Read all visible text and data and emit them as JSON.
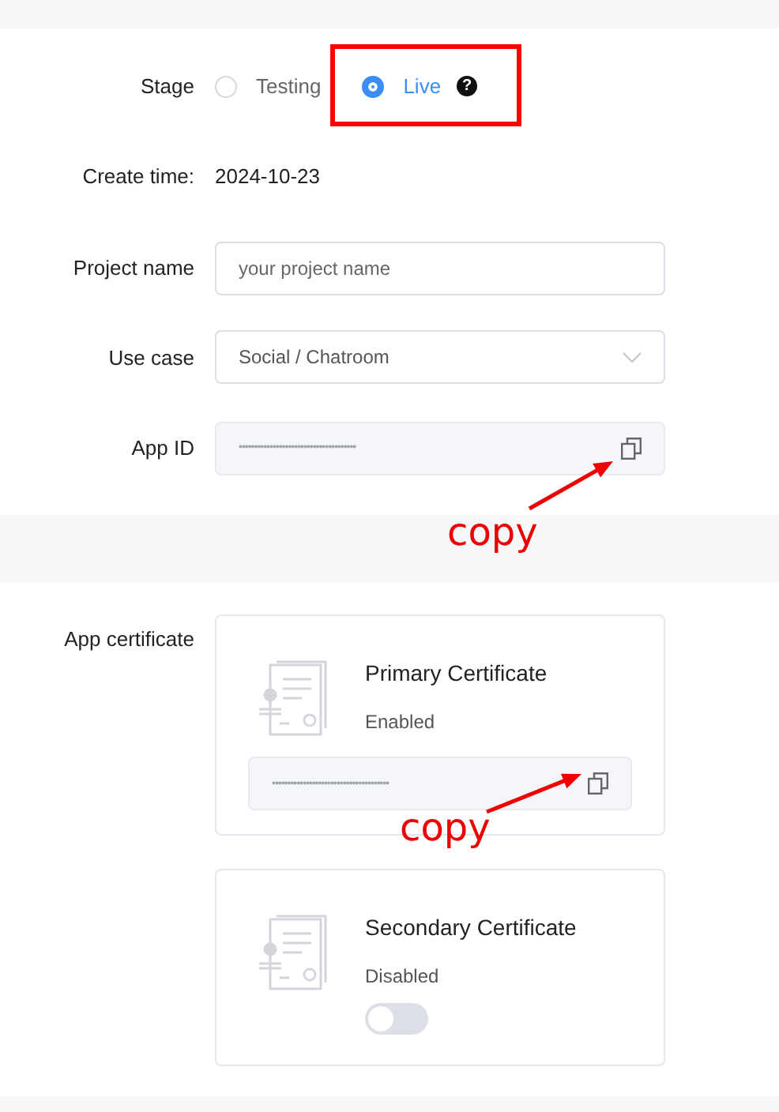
{
  "stage": {
    "label": "Stage",
    "options": [
      {
        "label": "Testing",
        "selected": false
      },
      {
        "label": "Live",
        "selected": true,
        "help": "?"
      }
    ]
  },
  "create_time": {
    "label": "Create time:",
    "value": "2024-10-23"
  },
  "project_name": {
    "label": "Project name",
    "placeholder": "your project name"
  },
  "use_case": {
    "label": "Use case",
    "value": "Social / Chatroom"
  },
  "app_id": {
    "label": "App ID",
    "value": "••••••••••••••••••••••••••••••••••••••"
  },
  "app_certificate": {
    "label": "App certificate",
    "cards": [
      {
        "title": "Primary Certificate",
        "status": "Enabled",
        "kind": "value",
        "value": "••••••••••••••••••••••••••••••••••••••"
      },
      {
        "title": "Secondary Certificate",
        "status": "Disabled",
        "kind": "toggle",
        "on": false
      }
    ]
  },
  "annotations": [
    {
      "kind": "box"
    },
    {
      "kind": "arrow",
      "text": "copy"
    },
    {
      "kind": "arrow",
      "text": "copy"
    }
  ]
}
